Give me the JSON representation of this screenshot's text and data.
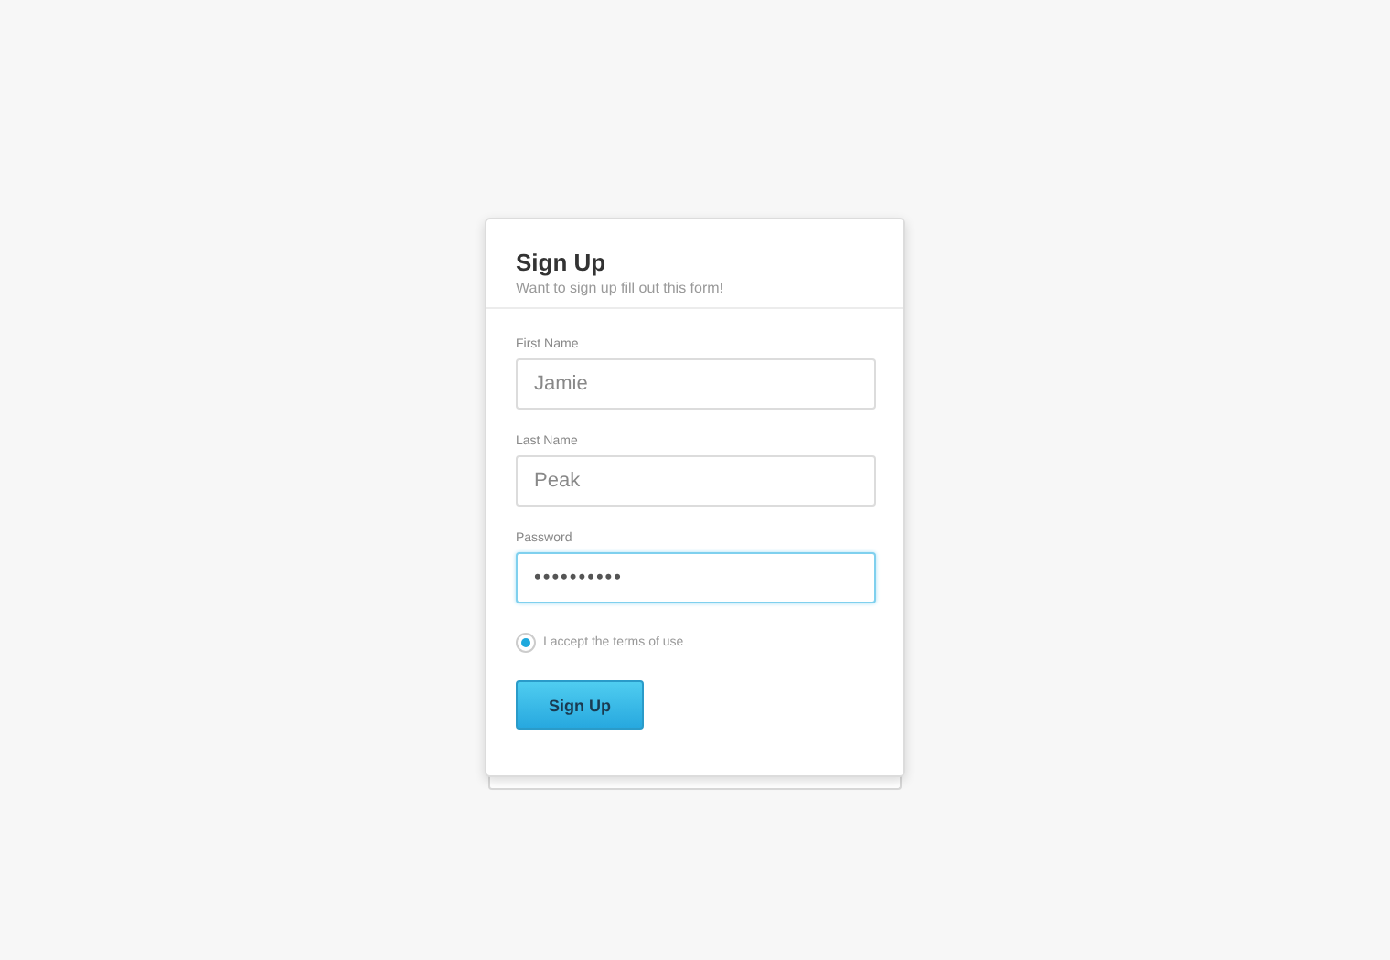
{
  "form": {
    "title": "Sign Up",
    "subtitle": "Want to sign up fill out this form!",
    "fields": [
      {
        "label": "First Name",
        "value": "Jamie",
        "focused": false
      },
      {
        "label": "Last Name",
        "value": "Peak",
        "focused": false
      },
      {
        "label": "Password",
        "value": "••••••••••",
        "focused": true
      }
    ],
    "terms": {
      "label": "I accept the terms of use",
      "checked": true
    },
    "submit": "Sign Up"
  }
}
